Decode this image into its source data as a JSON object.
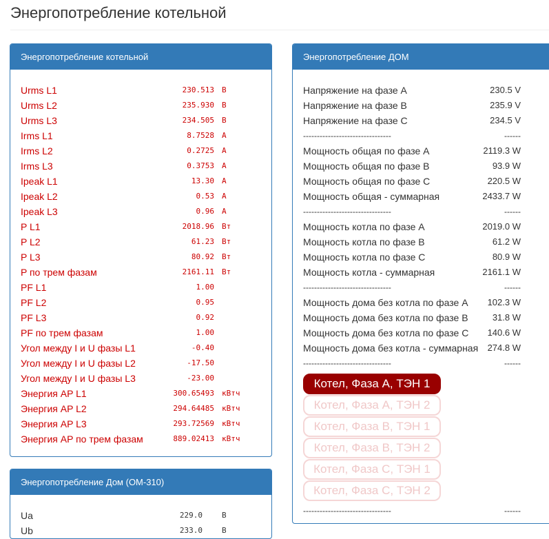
{
  "page": {
    "title": "Энергопотребление котельной"
  },
  "panel_boiler": {
    "title": "Энергопотребление котельной",
    "rows": [
      {
        "label": "Urms L1",
        "value": "230.513",
        "unit": "В"
      },
      {
        "label": "Urms L2",
        "value": "235.930",
        "unit": "В"
      },
      {
        "label": "Urms L3",
        "value": "234.505",
        "unit": "В"
      },
      {
        "label": "Irms L1",
        "value": "8.7528",
        "unit": "А"
      },
      {
        "label": "Irms L2",
        "value": "0.2725",
        "unit": "А"
      },
      {
        "label": "Irms L3",
        "value": "0.3753",
        "unit": "А"
      },
      {
        "label": "Ipeak L1",
        "value": "13.30",
        "unit": "А"
      },
      {
        "label": "Ipeak L2",
        "value": "0.53",
        "unit": "А"
      },
      {
        "label": "Ipeak L3",
        "value": "0.96",
        "unit": "А"
      },
      {
        "label": "P L1",
        "value": "2018.96",
        "unit": "Вт"
      },
      {
        "label": "P L2",
        "value": "61.23",
        "unit": "Вт"
      },
      {
        "label": "P L3",
        "value": "80.92",
        "unit": "Вт"
      },
      {
        "label": "P по трем фазам",
        "value": "2161.11",
        "unit": "Вт"
      },
      {
        "label": "PF L1",
        "value": "1.00",
        "unit": ""
      },
      {
        "label": "PF L2",
        "value": "0.95",
        "unit": ""
      },
      {
        "label": "PF L3",
        "value": "0.92",
        "unit": ""
      },
      {
        "label": "PF по трем фазам",
        "value": "1.00",
        "unit": ""
      },
      {
        "label": "Угол между I и U фазы L1",
        "value": "-0.40",
        "unit": ""
      },
      {
        "label": "Угол между I и U фазы L2",
        "value": "-17.50",
        "unit": ""
      },
      {
        "label": "Угол между I и U фазы L3",
        "value": "-23.00",
        "unit": ""
      },
      {
        "label": "Энергия AP L1",
        "value": "300.65493",
        "unit": "кВтч"
      },
      {
        "label": "Энергия AP L2",
        "value": "294.64485",
        "unit": "кВтч"
      },
      {
        "label": "Энергия AP L3",
        "value": "293.72569",
        "unit": "кВтч"
      },
      {
        "label": "Энергия AP по трем фазам",
        "value": "889.02413",
        "unit": "кВтч"
      }
    ]
  },
  "panel_house_om": {
    "title": "Энергопотребление Дом (ОМ-310)",
    "rows": [
      {
        "label": "Ua",
        "value": "229.0",
        "unit": "В"
      },
      {
        "label": "Ub",
        "value": "233.0",
        "unit": "В"
      }
    ]
  },
  "panel_house": {
    "title": "Энергопотребление ДОМ",
    "separator_left": "--------------------------------",
    "separator_right": "------",
    "groups": [
      [
        {
          "label": "Напряжение на фазе A",
          "value": "230.5 V"
        },
        {
          "label": "Напряжение на фазе B",
          "value": "235.9 V"
        },
        {
          "label": "Напряжение на фазе C",
          "value": "234.5 V"
        }
      ],
      [
        {
          "label": "Мощность общая по фазе A",
          "value": "2119.3 W"
        },
        {
          "label": "Мощность общая по фазе B",
          "value": "93.9 W"
        },
        {
          "label": "Мощность общая по фазе C",
          "value": "220.5 W"
        },
        {
          "label": "Мощность общая - суммарная",
          "value": "2433.7 W"
        }
      ],
      [
        {
          "label": "Мощность котла по фазе A",
          "value": "2019.0 W"
        },
        {
          "label": "Мощность котла по фазе B",
          "value": "61.2 W"
        },
        {
          "label": "Мощность котла по фазе C",
          "value": "80.9 W"
        },
        {
          "label": "Мощность котла - суммарная",
          "value": "2161.1 W"
        }
      ],
      [
        {
          "label": "Мощность дома без котла по фазе A",
          "value": "102.3 W"
        },
        {
          "label": "Мощность дома без котла по фазе B",
          "value": "31.8 W"
        },
        {
          "label": "Мощность дома без котла по фазе C",
          "value": "140.6 W"
        },
        {
          "label": "Мощность дома без котла - суммарная",
          "value": "274.8 W"
        }
      ]
    ],
    "buttons": [
      {
        "label": "Котел, Фаза A, ТЭН 1",
        "active": true
      },
      {
        "label": "Котел, Фаза A, ТЭН 2",
        "active": false
      },
      {
        "label": "Котел, Фаза B, ТЭН 1",
        "active": false
      },
      {
        "label": "Котел, Фаза B, ТЭН 2",
        "active": false
      },
      {
        "label": "Котел, Фаза C, ТЭН 1",
        "active": false
      },
      {
        "label": "Котел, Фаза C, ТЭН 2",
        "active": false
      }
    ]
  },
  "colors": {
    "panel_primary": "#337ab7",
    "value_red": "#cc0000",
    "button_active": "#990000"
  }
}
